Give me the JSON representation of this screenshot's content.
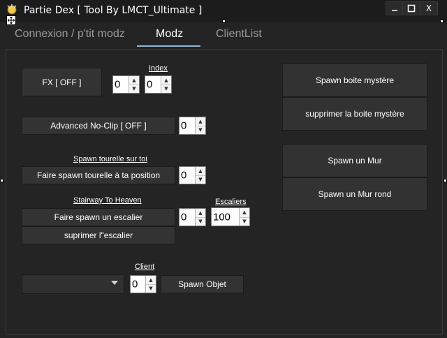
{
  "window": {
    "title": "Partie Dex [ Tool By LMCT_Ultimate ]",
    "minimize_icon": "minimize-icon",
    "maximize_icon": "maximize-icon",
    "close_label": "X"
  },
  "tabs": [
    {
      "label": "Connexion / p'tit modz",
      "active": false
    },
    {
      "label": "Modz",
      "active": true
    },
    {
      "label": "ClientList",
      "active": false
    }
  ],
  "colors": {
    "background": "#242424",
    "tab_underline": "#8fb6d6",
    "button": "#333333"
  },
  "fx": {
    "button": "FX [ OFF ]",
    "value1": "0",
    "index_label": "Index",
    "index_value": "0"
  },
  "noclip": {
    "button": "Advanced No-Clip [ OFF ]",
    "value": "0"
  },
  "turret": {
    "label": "Spawn tourelle sur toi",
    "button": "Faire spawn tourelle à ta position",
    "value": "0"
  },
  "stairway": {
    "label": "Stairway To Heaven",
    "spawn_button": "Faire spawn un escalier",
    "remove_button": "suprimer l\"escalier",
    "value": "0",
    "escaliers_label": "Escaliers",
    "escaliers_value": "100"
  },
  "client": {
    "label": "Client",
    "selected": "",
    "value": "0",
    "spawn_button": "Spawn Objet"
  },
  "right": {
    "spawn_box": "Spawn boite mystère",
    "remove_box": "supprimer la boite mystère",
    "spawn_wall": "Spawn un Mur",
    "spawn_round_wall": "Spawn un Mur rond"
  }
}
